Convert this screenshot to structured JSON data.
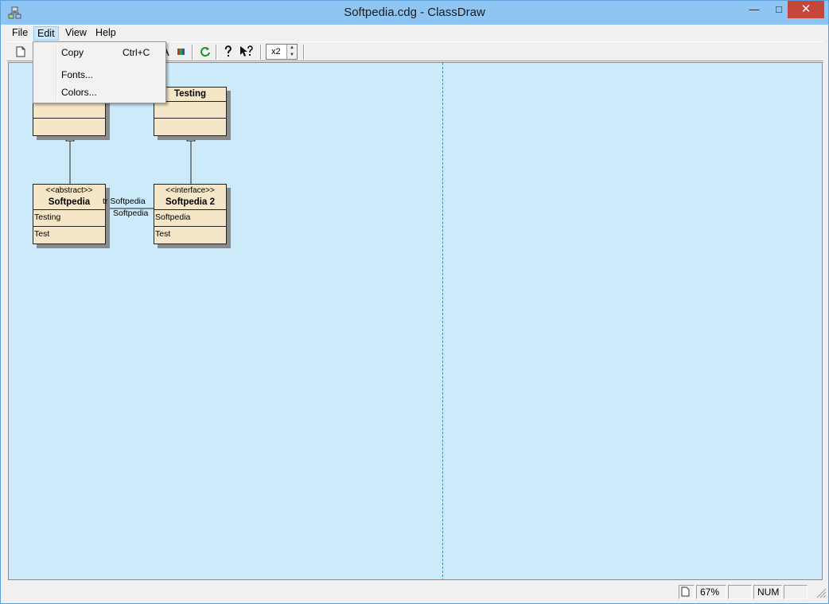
{
  "window": {
    "title": "Softpedia.cdg - ClassDraw",
    "minimize_glyph": "—",
    "maximize_glyph": "□",
    "close_glyph": "✕"
  },
  "menubar": {
    "items": [
      {
        "label": "File"
      },
      {
        "label": "Edit"
      },
      {
        "label": "View"
      },
      {
        "label": "Help"
      }
    ]
  },
  "toolbar": {
    "icons": [
      "new-document-icon",
      "fonts-icon",
      "colors-icon",
      "refresh-icon",
      "help-icon",
      "context-help-icon"
    ],
    "zoom_value": "x2"
  },
  "edit_menu": {
    "items": [
      {
        "label": "Copy",
        "shortcut": "Ctrl+C"
      },
      {
        "label": "Fonts...",
        "shortcut": ""
      },
      {
        "label": "Colors...",
        "shortcut": ""
      }
    ]
  },
  "diagram": {
    "classes": [
      {
        "name": "",
        "stereotype": "",
        "sections": [
          "",
          ""
        ]
      },
      {
        "name": "Testing",
        "stereotype": "",
        "sections": [
          "",
          ""
        ]
      },
      {
        "name": "Softpedia",
        "stereotype": "<<abstract>>",
        "sections": [
          "Testing",
          "Test"
        ]
      },
      {
        "name": "Softpedia 2",
        "stereotype": "<<interface>>",
        "sections": [
          "Softpedia",
          "Test"
        ]
      }
    ],
    "association_labels": [
      "tr Softpedia",
      "Softpedia"
    ],
    "colors": {
      "class_fill": "#f4e6c6",
      "canvas": "#cdeafb",
      "page_break": "#3a8fb0"
    }
  },
  "statusbar": {
    "zoom": "67%",
    "num_lock": "NUM"
  }
}
